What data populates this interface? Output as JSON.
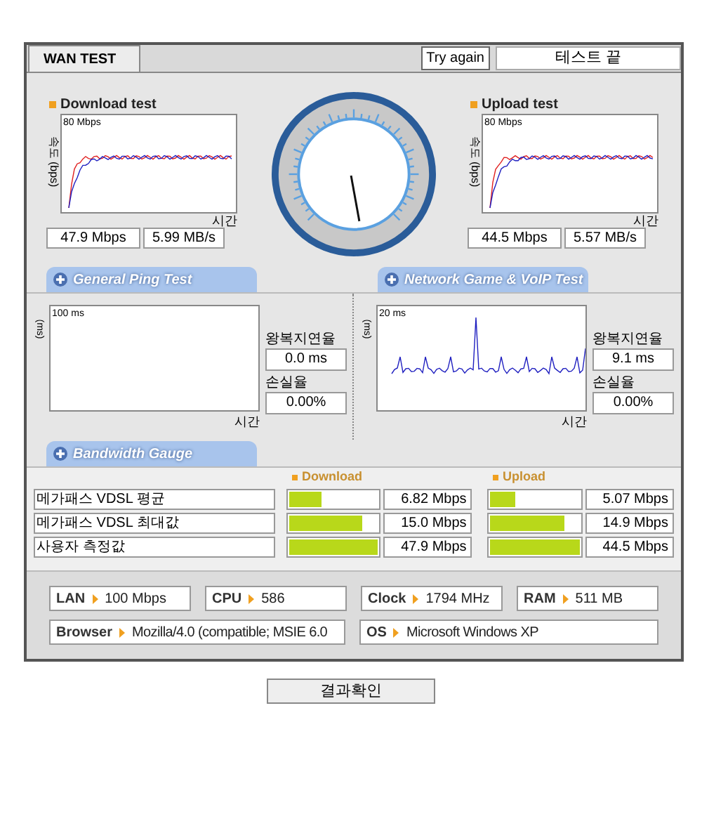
{
  "header": {
    "tab": "WAN TEST",
    "retry_button": "Try again",
    "status": "테스트 끝"
  },
  "speed_tests": [
    {
      "title": "Download test",
      "scale": "80 Mbps",
      "axis_label": "속도 (bps)",
      "time_label": "시간",
      "rate": "47.9 Mbps",
      "bytes": "5.99 MB/s"
    },
    {
      "title": "Upload test",
      "scale": "80 Mbps",
      "axis_label": "속도 (bps)",
      "time_label": "시간",
      "rate": "44.5 Mbps",
      "bytes": "5.57 MB/s"
    }
  ],
  "section_tabs": [
    {
      "label": "General Ping Test"
    },
    {
      "label": "Network Game & VoIP Test"
    }
  ],
  "ping_tests": [
    {
      "scale": "100 ms",
      "axis_label": "(ms)",
      "time_label": "시간",
      "rtt_label": "왕복지연율",
      "rtt": "0.0 ms",
      "loss_label": "손실율",
      "loss": "0.00%",
      "has_trace": false
    },
    {
      "scale": "20 ms",
      "axis_label": "(ms)",
      "time_label": "시간",
      "rtt_label": "왕복지연율",
      "rtt": "9.1 ms",
      "loss_label": "손실율",
      "loss": "0.00%",
      "has_trace": true
    }
  ],
  "bandwidth": {
    "tab": "Bandwidth Gauge",
    "download_label": "Download",
    "upload_label": "Upload",
    "rows": [
      {
        "label": "메가패스 VDSL 평균",
        "download": {
          "level": 0.37,
          "value": "6.82 Mbps"
        },
        "upload": {
          "level": 0.27,
          "value": "5.07 Mbps"
        }
      },
      {
        "label": "메가패스 VDSL 최대값",
        "download": {
          "level": 0.82,
          "value": "15.0 Mbps"
        },
        "upload": {
          "level": 0.82,
          "value": "14.9 Mbps"
        }
      },
      {
        "label": "사용자 측정값",
        "download": {
          "level": 1,
          "value": "47.9 Mbps"
        },
        "upload": {
          "level": 1,
          "value": "44.5 Mbps"
        }
      }
    ]
  },
  "system_info": [
    {
      "label": "LAN",
      "value": "100 Mbps"
    },
    {
      "label": "CPU",
      "value": "586"
    },
    {
      "label": "Clock",
      "value": "1794 MHz"
    },
    {
      "label": "RAM",
      "value": "511 MB"
    },
    {
      "label": "Browser",
      "value": "Mozilla/4.0 (compatible; MSIE 6.0"
    },
    {
      "label": "OS",
      "value": "Microsoft Windows XP"
    }
  ],
  "result_button": "결과확인"
}
